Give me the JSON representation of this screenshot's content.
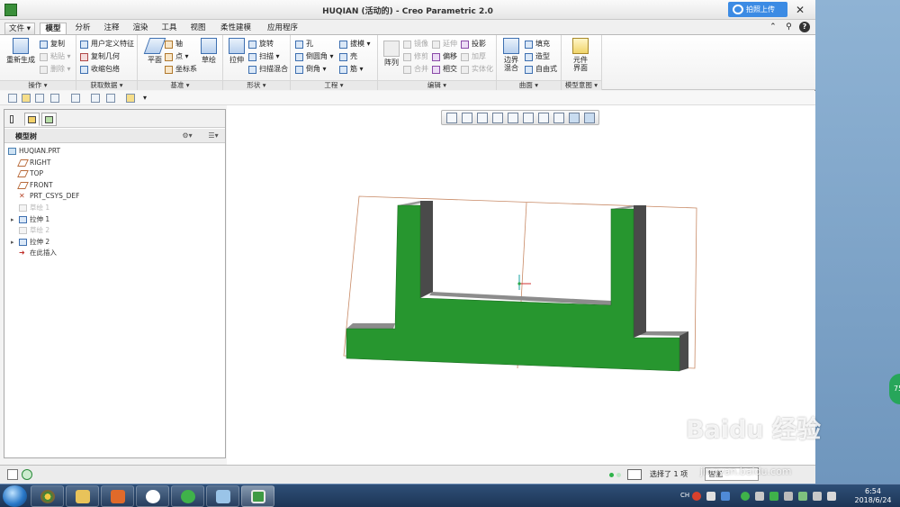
{
  "window": {
    "title": "HUQIAN (活动的) - Creo Parametric 2.0",
    "upload_label": "拍照上传",
    "close_glyph": "✕"
  },
  "menubar": {
    "file": "文件",
    "tabs": [
      "模型",
      "分析",
      "注释",
      "渲染",
      "工具",
      "视图",
      "柔性建模",
      "应用程序"
    ],
    "active_tab": "模型"
  },
  "ribbon": {
    "groups": {
      "operations": "操作",
      "get_data": "获取数据",
      "datum": "基准",
      "shapes": "形状",
      "engineering": "工程",
      "editing": "编辑",
      "surfaces": "曲面",
      "model_intent": "模型意图"
    },
    "operations": {
      "regenerate": "重新生成",
      "copy": "复制",
      "paste": "粘贴",
      "delete": "删除"
    },
    "get_data": {
      "udf": "用户定义特征",
      "copy_geom": "复制几何",
      "shrinkwrap": "收缩包络"
    },
    "datum": {
      "plane": "平面",
      "axis": "轴",
      "point": "点",
      "csys": "坐标系",
      "sketch": "草绘"
    },
    "shapes": {
      "extrude": "拉伸",
      "revolve": "旋转",
      "sweep": "扫描",
      "swept_blend": "扫描混合"
    },
    "engineering": {
      "hole": "孔",
      "draft": "拔模",
      "round": "倒圆角",
      "shell": "壳",
      "chamfer": "倒角",
      "rib": "筋"
    },
    "editing": {
      "pattern": "阵列",
      "mirror": "镜像",
      "extend": "延伸",
      "project": "投影",
      "trim": "修剪",
      "offset": "偏移",
      "thicken": "加厚",
      "merge": "合并",
      "intersect": "相交",
      "solidify": "实体化"
    },
    "surfaces": {
      "boundary_blend": "边界混合",
      "fill": "填充",
      "style": "造型",
      "freestyle": "自由式"
    },
    "model_intent": {
      "component_interface": "元件界面"
    }
  },
  "model_tree": {
    "title": "模型树",
    "nodes": [
      {
        "label": "HUQIAN.PRT",
        "icon": "part-icon",
        "dim": false,
        "expand": ""
      },
      {
        "label": "RIGHT",
        "icon": "datum-plane-icon",
        "dim": false,
        "expand": ""
      },
      {
        "label": "TOP",
        "icon": "datum-plane-icon",
        "dim": false,
        "expand": ""
      },
      {
        "label": "FRONT",
        "icon": "datum-plane-icon",
        "dim": false,
        "expand": ""
      },
      {
        "label": "PRT_CSYS_DEF",
        "icon": "csys-icon",
        "dim": false,
        "expand": ""
      },
      {
        "label": "草绘 1",
        "icon": "sketch-icon",
        "dim": true,
        "expand": ""
      },
      {
        "label": "拉伸 1",
        "icon": "extrude-icon",
        "dim": false,
        "expand": "▸"
      },
      {
        "label": "草绘 2",
        "icon": "sketch-icon",
        "dim": true,
        "expand": ""
      },
      {
        "label": "拉伸 2",
        "icon": "extrude-icon",
        "dim": false,
        "expand": "▸"
      },
      {
        "label": "在此插入",
        "icon": "insert-arrow-icon",
        "dim": false,
        "expand": ""
      }
    ]
  },
  "statusbar": {
    "selected": "选择了 1 项",
    "filter": "智能"
  },
  "taskbar": {
    "lang": "CH",
    "time": "6:54",
    "date": "2018/6/24"
  },
  "overlay": {
    "side_bubble": "75",
    "watermark": "Baidu 经验",
    "watermark_sub": "jingyan.baidu.com"
  }
}
